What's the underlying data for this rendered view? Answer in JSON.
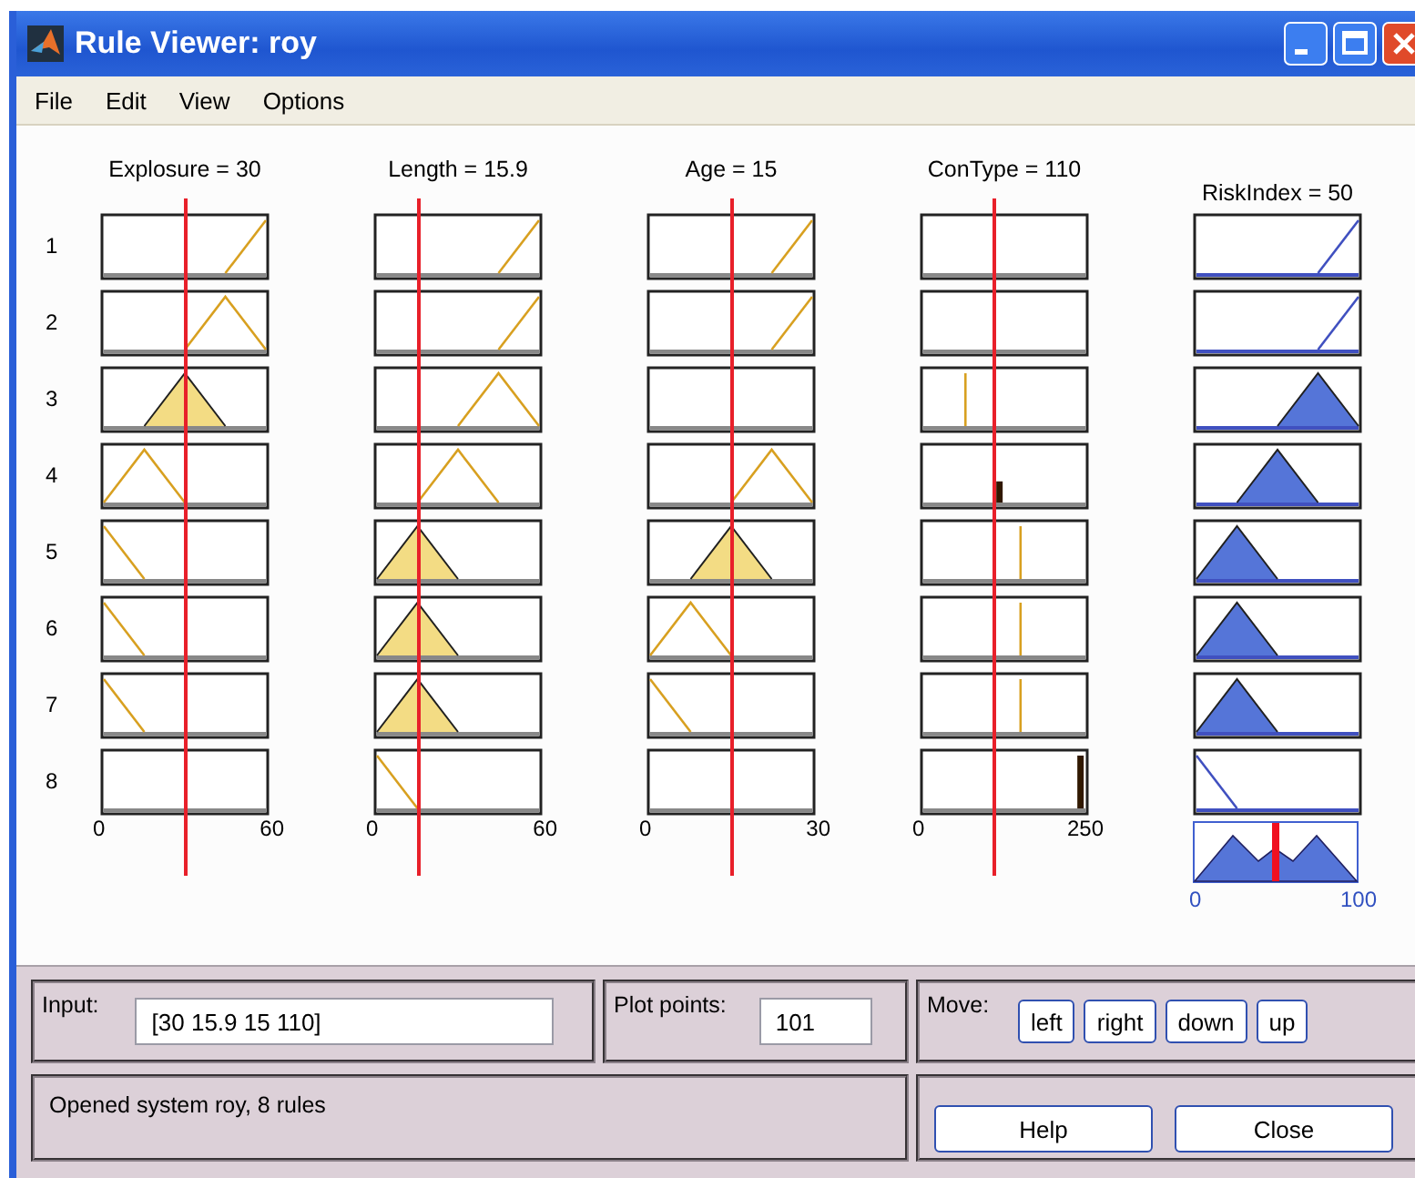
{
  "window": {
    "title": "Rule Viewer: roy"
  },
  "menu": [
    "File",
    "Edit",
    "View",
    "Options"
  ],
  "rule_numbers": [
    "1",
    "2",
    "3",
    "4",
    "5",
    "6",
    "7",
    "8"
  ],
  "columns": [
    {
      "label": "Explosure = 30",
      "kind": "input",
      "axis": [
        "0",
        "60"
      ],
      "cells": [
        {
          "kind": "ramp-up",
          "filled": false
        },
        {
          "kind": "tri-high",
          "filled": false
        },
        {
          "kind": "tri-mid",
          "filled": true
        },
        {
          "kind": "tri-low",
          "filled": false
        },
        {
          "kind": "ramp-down",
          "filled": false
        },
        {
          "kind": "ramp-down",
          "filled": false
        },
        {
          "kind": "ramp-down",
          "filled": false
        },
        {
          "kind": "empty"
        }
      ]
    },
    {
      "label": "Length = 15.9",
      "kind": "input",
      "axis": [
        "0",
        "60"
      ],
      "cells": [
        {
          "kind": "ramp-up",
          "filled": false
        },
        {
          "kind": "ramp-up",
          "filled": false
        },
        {
          "kind": "tri-high",
          "filled": false
        },
        {
          "kind": "tri-mid",
          "filled": false
        },
        {
          "kind": "tri-low",
          "filled": true
        },
        {
          "kind": "tri-low",
          "filled": true
        },
        {
          "kind": "tri-low",
          "filled": true
        },
        {
          "kind": "ramp-down",
          "filled": false
        }
      ]
    },
    {
      "label": "Age = 15",
      "kind": "input",
      "axis": [
        "0",
        "30"
      ],
      "cells": [
        {
          "kind": "ramp-up",
          "filled": false
        },
        {
          "kind": "ramp-up",
          "filled": false
        },
        {
          "kind": "empty"
        },
        {
          "kind": "tri-high",
          "filled": false
        },
        {
          "kind": "tri-mid",
          "filled": true
        },
        {
          "kind": "tri-low",
          "filled": false
        },
        {
          "kind": "ramp-down",
          "filled": false
        },
        {
          "kind": "empty"
        }
      ]
    },
    {
      "label": "ConType = 110",
      "kind": "input",
      "axis": [
        "0",
        "250"
      ],
      "cells": [
        {
          "kind": "empty"
        },
        {
          "kind": "empty"
        },
        {
          "kind": "spike-low",
          "filled": false
        },
        {
          "kind": "spike-mid",
          "filled": true
        },
        {
          "kind": "spike-right",
          "filled": false
        },
        {
          "kind": "spike-right",
          "filled": false
        },
        {
          "kind": "spike-right",
          "filled": false
        },
        {
          "kind": "spike-end",
          "filled": true
        }
      ]
    },
    {
      "label": "RiskIndex = 50",
      "kind": "output",
      "level": 0.5,
      "axis": [
        "0",
        "100"
      ],
      "cells": [
        {
          "kind": "ramp-up",
          "filled": false
        },
        {
          "kind": "ramp-up",
          "filled": false
        },
        {
          "kind": "tri-high",
          "filled": true
        },
        {
          "kind": "tri-mid",
          "filled": true
        },
        {
          "kind": "tri-low",
          "filled": true
        },
        {
          "kind": "tri-low",
          "filled": true
        },
        {
          "kind": "tri-low",
          "filled": true
        },
        {
          "kind": "ramp-down",
          "filled": false
        }
      ]
    }
  ],
  "input": {
    "label": "Input:",
    "value": "[30 15.9 15 110]"
  },
  "plot_points": {
    "label": "Plot points:",
    "value": "101"
  },
  "move": {
    "label": "Move:",
    "buttons": [
      "left",
      "right",
      "down",
      "up"
    ]
  },
  "status": "Opened system roy, 8 rules",
  "buttons": [
    "Help",
    "Close"
  ]
}
